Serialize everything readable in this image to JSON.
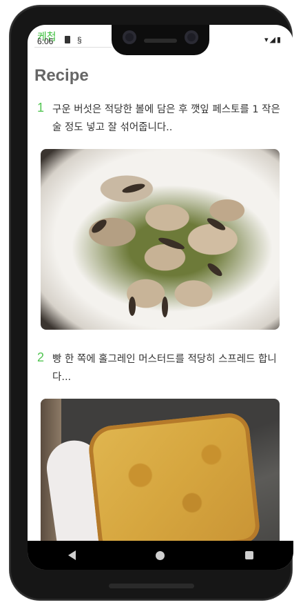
{
  "status_bar": {
    "time": "6:06",
    "right_icons": "▾◢▮"
  },
  "overlay_title": "케첩",
  "header": {
    "title": "Recipe"
  },
  "steps": [
    {
      "number": "1",
      "text": "구운 버섯은 적당한 볼에 담은 후 깻잎 페스토를 1 작은술 정도 넣고 잘 섞어줍니다..",
      "image_icon": "sauteed-mushrooms-photo"
    },
    {
      "number": "2",
      "text": "빵 한 쪽에 홀그레인 머스터드를 적당히 스프레드 합니다...",
      "image_icon": "mustard-toast-photo"
    }
  ],
  "nav": {
    "back_icon": "back-icon",
    "home_icon": "home-icon",
    "recents_icon": "recents-icon"
  },
  "colors": {
    "step_number": "#52c552",
    "overlay_title": "#3cbf3c",
    "header": "#666666"
  }
}
